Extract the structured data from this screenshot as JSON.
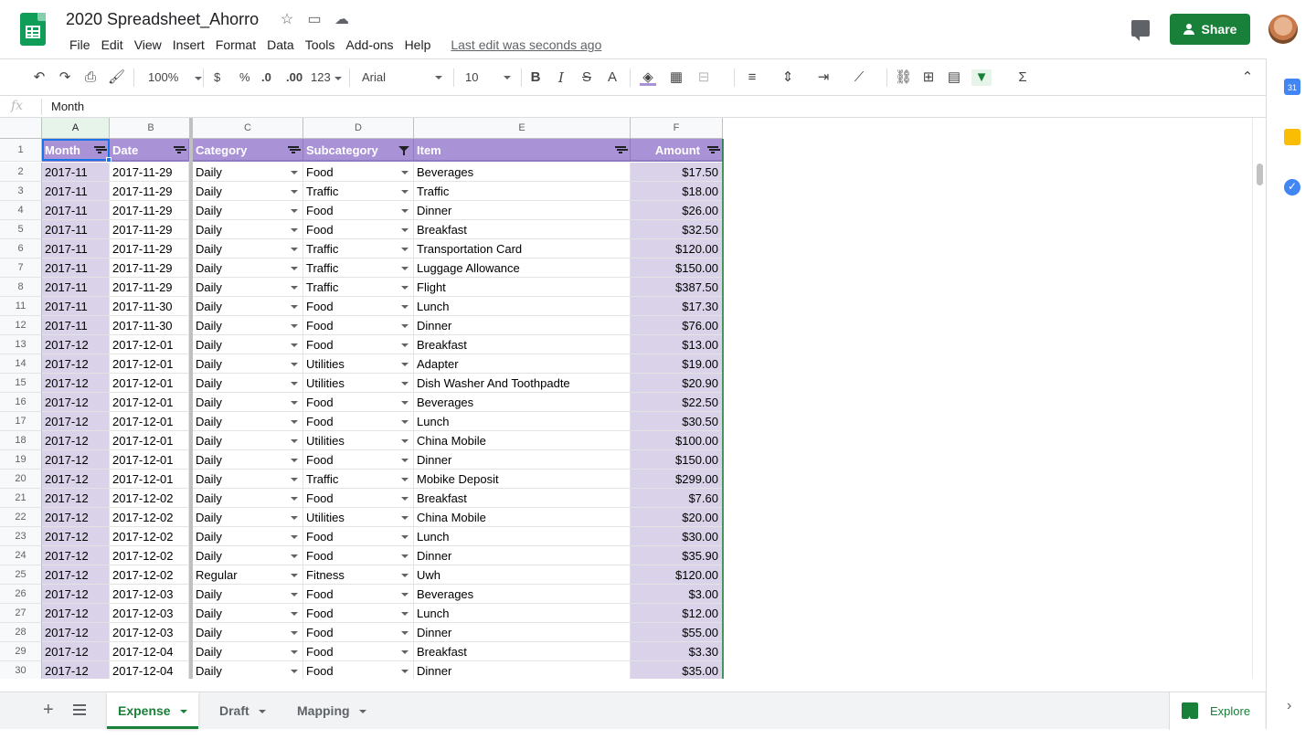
{
  "app": {
    "title": "2020 Spreadsheet_Ahorro",
    "menu": [
      "File",
      "Edit",
      "View",
      "Insert",
      "Format",
      "Data",
      "Tools",
      "Add-ons",
      "Help"
    ],
    "last_edit": "Last edit was seconds ago",
    "share_label": "Share"
  },
  "toolbar": {
    "zoom": "100%",
    "currency": "$",
    "percent": "%",
    "dec_decrease": ".0",
    "dec_increase": ".00",
    "more_formats": "123",
    "font": "Arial",
    "font_size": "10"
  },
  "formula_bar": {
    "fx": "fx",
    "content": "Month"
  },
  "columns": [
    "A",
    "B",
    "C",
    "D",
    "E",
    "F"
  ],
  "header_row": {
    "row_number": "1",
    "cells": [
      "Month",
      "Date",
      "Category",
      "Subcategory",
      "Item",
      "Amount"
    ]
  },
  "rows": [
    {
      "n": "2",
      "cells": [
        "2017-11",
        "2017-11-29",
        "Daily",
        "Food",
        "Beverages",
        "$17.50"
      ]
    },
    {
      "n": "3",
      "cells": [
        "2017-11",
        "2017-11-29",
        "Daily",
        "Traffic",
        "Traffic",
        "$18.00"
      ]
    },
    {
      "n": "4",
      "cells": [
        "2017-11",
        "2017-11-29",
        "Daily",
        "Food",
        "Dinner",
        "$26.00"
      ]
    },
    {
      "n": "5",
      "cells": [
        "2017-11",
        "2017-11-29",
        "Daily",
        "Food",
        "Breakfast",
        "$32.50"
      ]
    },
    {
      "n": "6",
      "cells": [
        "2017-11",
        "2017-11-29",
        "Daily",
        "Traffic",
        "Transportation Card",
        "$120.00"
      ]
    },
    {
      "n": "7",
      "cells": [
        "2017-11",
        "2017-11-29",
        "Daily",
        "Traffic",
        "Luggage Allowance",
        "$150.00"
      ]
    },
    {
      "n": "8",
      "cells": [
        "2017-11",
        "2017-11-29",
        "Daily",
        "Traffic",
        "Flight",
        "$387.50"
      ]
    },
    {
      "n": "11",
      "cells": [
        "2017-11",
        "2017-11-30",
        "Daily",
        "Food",
        "Lunch",
        "$17.30"
      ]
    },
    {
      "n": "12",
      "cells": [
        "2017-11",
        "2017-11-30",
        "Daily",
        "Food",
        "Dinner",
        "$76.00"
      ]
    },
    {
      "n": "13",
      "cells": [
        "2017-12",
        "2017-12-01",
        "Daily",
        "Food",
        "Breakfast",
        "$13.00"
      ]
    },
    {
      "n": "14",
      "cells": [
        "2017-12",
        "2017-12-01",
        "Daily",
        "Utilities",
        "Adapter",
        "$19.00"
      ]
    },
    {
      "n": "15",
      "cells": [
        "2017-12",
        "2017-12-01",
        "Daily",
        "Utilities",
        "Dish Washer And Toothpadte",
        "$20.90"
      ]
    },
    {
      "n": "16",
      "cells": [
        "2017-12",
        "2017-12-01",
        "Daily",
        "Food",
        "Beverages",
        "$22.50"
      ]
    },
    {
      "n": "17",
      "cells": [
        "2017-12",
        "2017-12-01",
        "Daily",
        "Food",
        "Lunch",
        "$30.50"
      ]
    },
    {
      "n": "18",
      "cells": [
        "2017-12",
        "2017-12-01",
        "Daily",
        "Utilities",
        "China Mobile",
        "$100.00"
      ]
    },
    {
      "n": "19",
      "cells": [
        "2017-12",
        "2017-12-01",
        "Daily",
        "Food",
        "Dinner",
        "$150.00"
      ]
    },
    {
      "n": "20",
      "cells": [
        "2017-12",
        "2017-12-01",
        "Daily",
        "Traffic",
        "Mobike Deposit",
        "$299.00"
      ]
    },
    {
      "n": "21",
      "cells": [
        "2017-12",
        "2017-12-02",
        "Daily",
        "Food",
        "Breakfast",
        "$7.60"
      ]
    },
    {
      "n": "22",
      "cells": [
        "2017-12",
        "2017-12-02",
        "Daily",
        "Utilities",
        "China Mobile",
        "$20.00"
      ]
    },
    {
      "n": "23",
      "cells": [
        "2017-12",
        "2017-12-02",
        "Daily",
        "Food",
        "Lunch",
        "$30.00"
      ]
    },
    {
      "n": "24",
      "cells": [
        "2017-12",
        "2017-12-02",
        "Daily",
        "Food",
        "Dinner",
        "$35.90"
      ]
    },
    {
      "n": "25",
      "cells": [
        "2017-12",
        "2017-12-02",
        "Regular",
        "Fitness",
        "Uwh",
        "$120.00"
      ]
    },
    {
      "n": "26",
      "cells": [
        "2017-12",
        "2017-12-03",
        "Daily",
        "Food",
        "Beverages",
        "$3.00"
      ]
    },
    {
      "n": "27",
      "cells": [
        "2017-12",
        "2017-12-03",
        "Daily",
        "Food",
        "Lunch",
        "$12.00"
      ]
    },
    {
      "n": "28",
      "cells": [
        "2017-12",
        "2017-12-03",
        "Daily",
        "Food",
        "Dinner",
        "$55.00"
      ]
    },
    {
      "n": "29",
      "cells": [
        "2017-12",
        "2017-12-04",
        "Daily",
        "Food",
        "Breakfast",
        "$3.30"
      ]
    },
    {
      "n": "30",
      "cells": [
        "2017-12",
        "2017-12-04",
        "Daily",
        "Food",
        "Dinner",
        "$35.00"
      ]
    }
  ],
  "sheet_tabs": [
    "Expense",
    "Draft",
    "Mapping"
  ],
  "active_tab": "Expense",
  "explore_label": "Explore",
  "side_panel": {
    "calendar_day": "31"
  },
  "colors": {
    "accent": "#188038",
    "header_purple": "#a992d6",
    "band_purple": "#d9d2e9",
    "selection": "#1a73e8"
  }
}
